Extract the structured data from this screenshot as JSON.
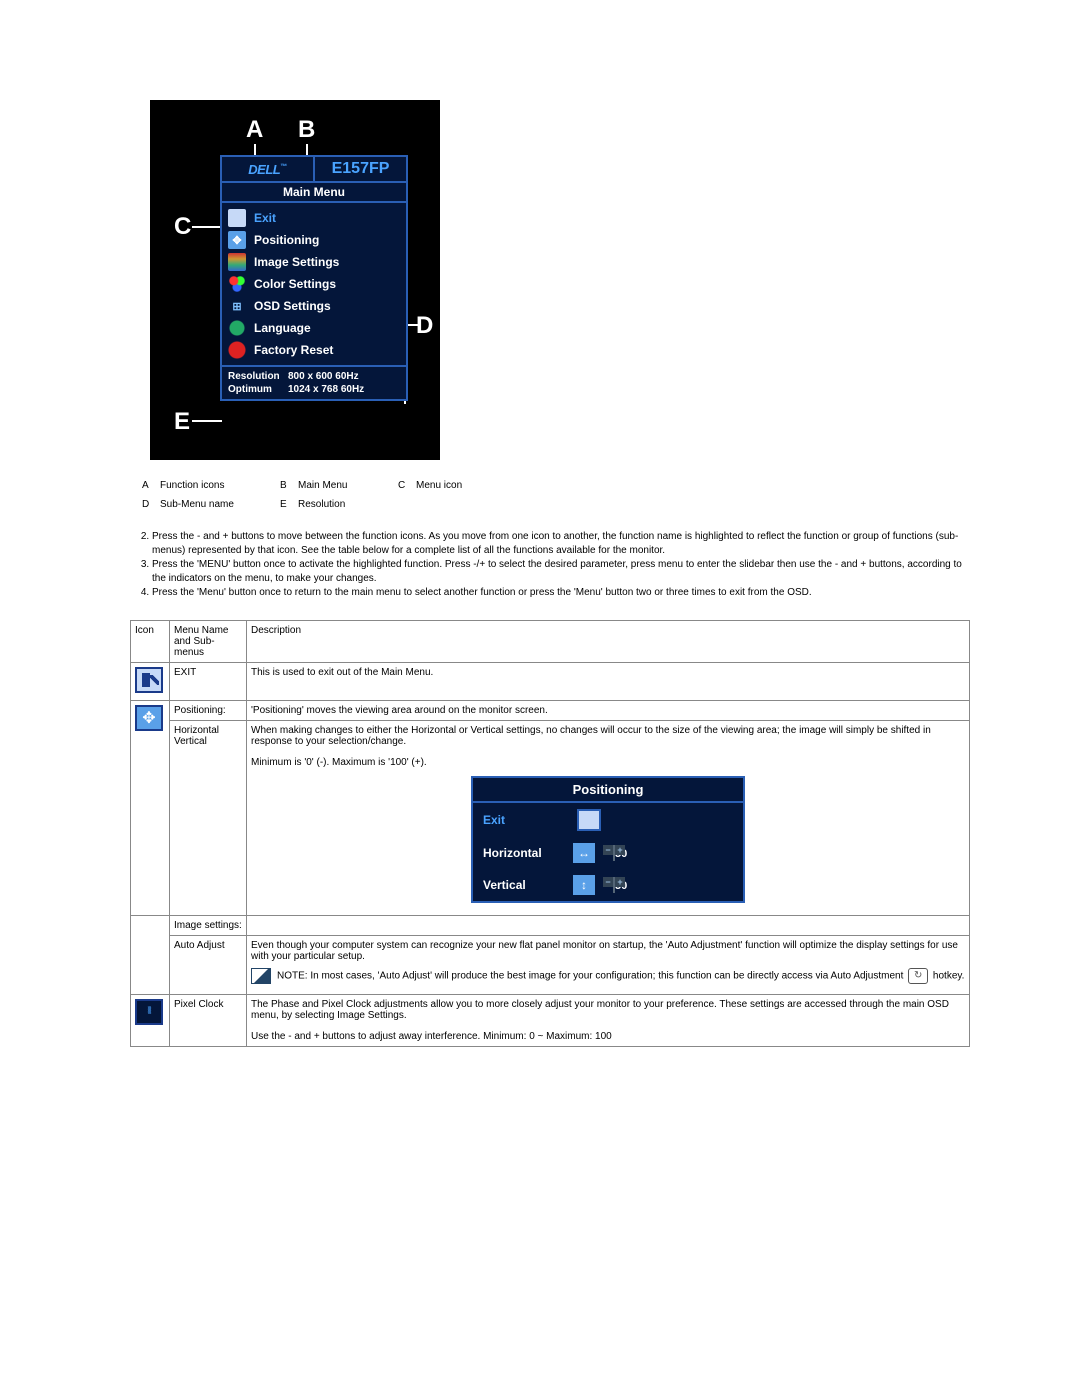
{
  "osd": {
    "brand": "DELL",
    "tm": "™",
    "model": "E157FP",
    "title": "Main Menu",
    "items": [
      {
        "label": "Exit",
        "cls": "ic-exit",
        "glyph": "",
        "hl": true
      },
      {
        "label": "Positioning",
        "cls": "ic-pos",
        "glyph": "✥"
      },
      {
        "label": "Image Settings",
        "cls": "ic-img",
        "glyph": ""
      },
      {
        "label": "Color Settings",
        "cls": "ic-col",
        "glyph": ""
      },
      {
        "label": "OSD Settings",
        "cls": "ic-osd",
        "glyph": "⊞"
      },
      {
        "label": "Language",
        "cls": "ic-lang",
        "glyph": ""
      },
      {
        "label": "Factory Reset",
        "cls": "ic-reset",
        "glyph": ""
      }
    ],
    "res": {
      "row1label": "Resolution",
      "row1val": "800 x 600  60Hz",
      "row2label": "Optimum",
      "row2val": "1024 x 768  60Hz"
    },
    "letters": {
      "A": "A",
      "B": "B",
      "C": "C",
      "D": "D",
      "E": "E"
    }
  },
  "defs": {
    "A": "Function icons",
    "B": "Main Menu",
    "C": "Menu icon",
    "D": "Sub-Menu name",
    "E": "Resolution"
  },
  "instr": [
    "Press the - and + buttons to move between the function icons. As you move from one icon to another, the function name is highlighted to reflect the function or group of functions (sub-menus) represented by that icon. See the table below for a complete list of all the functions available for the monitor.",
    "Press the 'MENU' button once to activate the highlighted function. Press -/+  to select the desired parameter, press menu to enter the slidebar then use the - and + buttons, according to the indicators on the menu, to make your changes.",
    "Press the 'Menu' button once to return to the main menu to select another function or press the 'Menu' button two or three times to exit from the OSD."
  ],
  "table": {
    "headers": {
      "icon": "Icon",
      "menu": "Menu Name and Sub-menus",
      "desc": "Description"
    },
    "rows": {
      "exit": {
        "name": "EXIT",
        "desc": "This is used to exit out of the Main Menu."
      },
      "positioning": {
        "name": "Positioning:",
        "desc": "'Positioning' moves the viewing area around on the monitor screen.",
        "sub1": "Horizontal Vertical",
        "sub1desc": "When making changes to either the Horizontal or Vertical settings, no changes will occur to the size of the viewing area; the image will simply be shifted in response to your selection/change.",
        "minmax": "Minimum is '0' (-). Maximum is '100' (+).",
        "posOsd": {
          "title": "Positioning",
          "exit": "Exit",
          "h": "Horizontal",
          "v": "Vertical",
          "hval": "50",
          "vval": "50"
        }
      },
      "image": {
        "name": "Image settings:",
        "autoLabel": "Auto Adjust",
        "autoDesc": "Even though your computer system can recognize your new flat panel monitor on startup, the 'Auto Adjustment' function will optimize the display settings for use with your particular setup.",
        "note1": "NOTE: In most cases, 'Auto Adjust' will produce the best image for your configuration; this function can be directly access via Auto Adjustment",
        "note1b": "hotkey.",
        "pixelLabel": "Pixel Clock",
        "pixelDesc": "The Phase and Pixel Clock adjustments allow you to more closely adjust your monitor to your preference. These settings are accessed through the main OSD menu, by selecting Image Settings.",
        "pixelDesc2": "Use the - and + buttons to adjust away interference. Minimum: 0 ~ Maximum: 100"
      }
    }
  }
}
